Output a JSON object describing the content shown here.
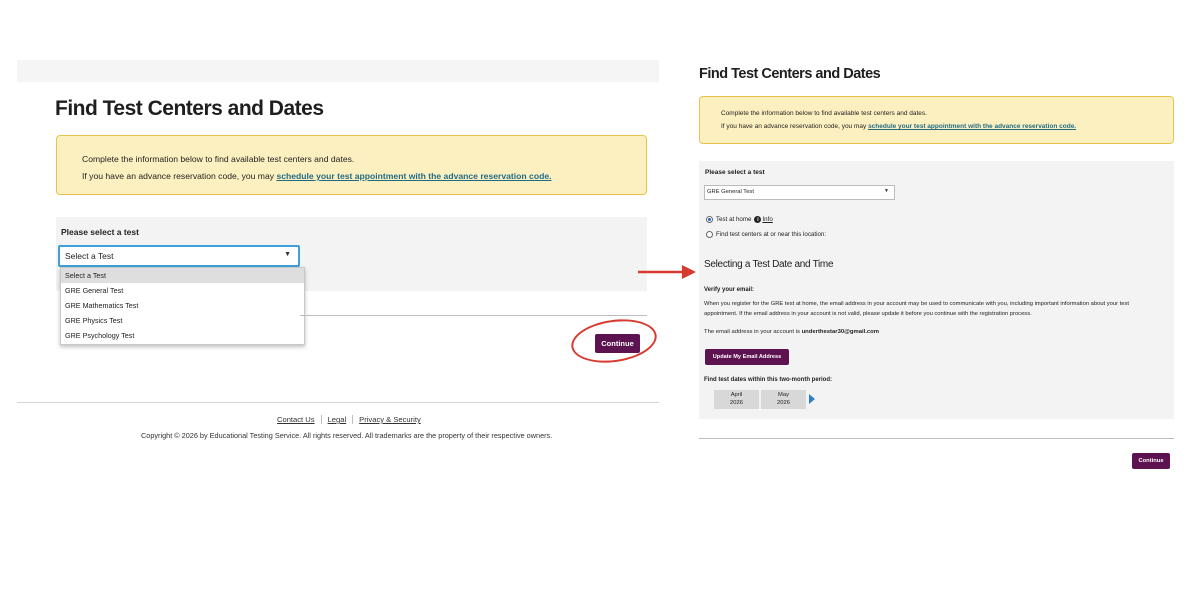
{
  "left": {
    "title": "Find Test Centers and Dates",
    "info_line1": "Complete the information below to find available test centers and dates.",
    "info_line2_prefix": "If you have an advance reservation code, you may ",
    "info_link": "schedule your test appointment with the advance reservation code.",
    "select_label": "Please select a test",
    "select_value": "Select a Test",
    "dropdown_options": [
      "Select a Test",
      "GRE General Test",
      "GRE Mathematics Test",
      "GRE Physics Test",
      "GRE Psychology Test"
    ],
    "continue_label": "Continue"
  },
  "footer": {
    "links": [
      "Contact Us",
      "Legal",
      "Privacy & Security"
    ],
    "copyright": "Copyright © 2026 by Educational Testing Service. All rights reserved. All trademarks are the property of their respective owners."
  },
  "right": {
    "title": "Find Test Centers and Dates",
    "info_line1": "Complete the information below to find available test centers and dates.",
    "info_line2_prefix": "If you have an advance reservation code, you may ",
    "info_link": "schedule your test appointment with the advance reservation code.",
    "select_label": "Please select a test",
    "select_value": "GRE General Test",
    "radio_home": "Test at home",
    "info_text": "Info",
    "radio_centers": "Find test centers at or near this location:",
    "section_title": "Selecting a Test Date and Time",
    "verify_label": "Verify your email:",
    "verify_desc": "When you register for the GRE test at home, the email address in your account may be used to communicate with you, including important information about your test appointment. If the email address in your account is not valid, please update it before you continue with the registration process.",
    "email_prefix": "The email address in your account is ",
    "email": "underthestar30@gmail.com",
    "update_button": "Update My Email Address",
    "dates_label": "Find test dates within this two-month period:",
    "months": [
      {
        "month": "April",
        "year": "2026"
      },
      {
        "month": "May",
        "year": "2026"
      }
    ],
    "continue_label": "Continue"
  },
  "colors": {
    "button": "#5c1350",
    "info_bg": "#fdf0c0",
    "info_border": "#e6c44c",
    "annotation_red": "#d83a2f",
    "focus_blue": "#3da0d6"
  }
}
